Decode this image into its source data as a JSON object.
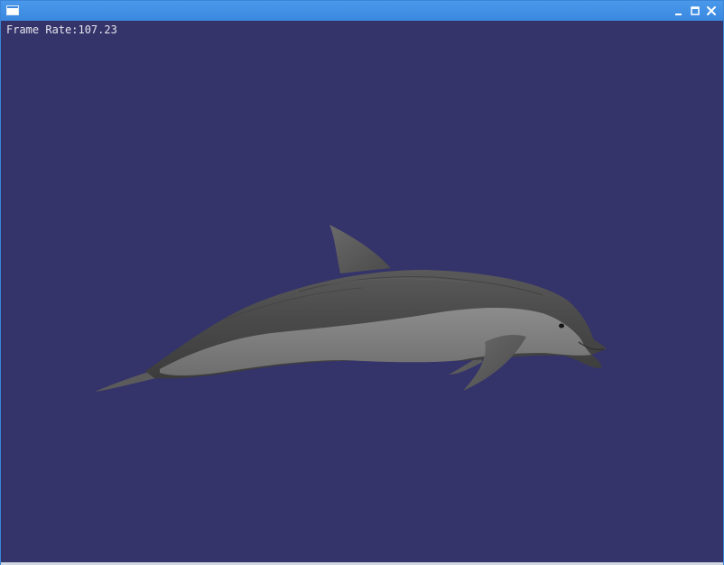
{
  "window": {
    "controls": [
      "minimize",
      "maximize",
      "close"
    ]
  },
  "overlay": {
    "frame_rate_label": "Frame Rate:",
    "frame_rate_value": "107.23"
  },
  "scene": {
    "background_color": "#34336a",
    "model": "dolphin"
  }
}
